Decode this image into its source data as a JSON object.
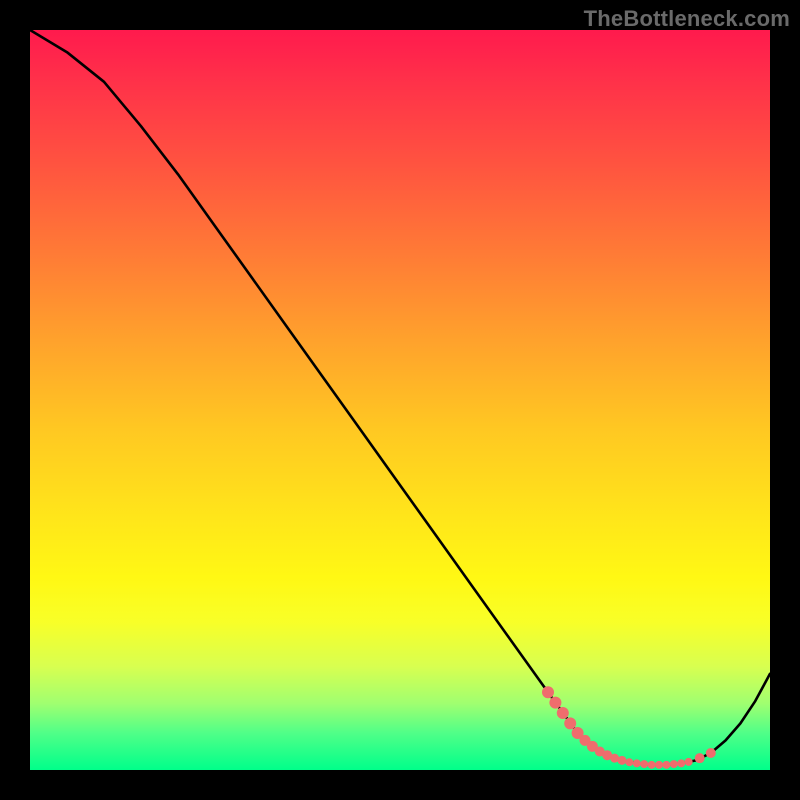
{
  "watermark": "TheBottleneck.com",
  "colors": {
    "curve_stroke": "#000000",
    "marker_fill": "#ef6d6d",
    "background": "#000000",
    "gradient_top": "#ff1a4d",
    "gradient_bottom": "#00ff8a"
  },
  "chart_data": {
    "type": "line",
    "title": "",
    "xlabel": "",
    "ylabel": "",
    "xlim": [
      0,
      100
    ],
    "ylim": [
      0,
      100
    ],
    "grid": false,
    "legend": false,
    "series": [
      {
        "name": "bottleneck-curve",
        "x": [
          0,
          5,
          10,
          15,
          20,
          25,
          30,
          35,
          40,
          45,
          50,
          55,
          60,
          65,
          70,
          74,
          76,
          78,
          80,
          82,
          84,
          86,
          88,
          90,
          92,
          94,
          96,
          98,
          100
        ],
        "y": [
          100,
          97,
          93,
          87,
          80.5,
          73.5,
          66.5,
          59.5,
          52.5,
          45.5,
          38.5,
          31.5,
          24.5,
          17.5,
          10.5,
          5,
          3.2,
          2,
          1.3,
          0.9,
          0.7,
          0.7,
          0.9,
          1.3,
          2.3,
          4,
          6.3,
          9.3,
          13
        ]
      }
    ],
    "markers": {
      "series": "bottleneck-curve",
      "color": "#ef6d6d",
      "points": [
        {
          "x": 70,
          "y": 10.5,
          "r": 6
        },
        {
          "x": 71,
          "y": 9.1,
          "r": 6
        },
        {
          "x": 72,
          "y": 7.7,
          "r": 6
        },
        {
          "x": 73,
          "y": 6.3,
          "r": 6
        },
        {
          "x": 74,
          "y": 5.0,
          "r": 6
        },
        {
          "x": 75,
          "y": 4.0,
          "r": 5.5
        },
        {
          "x": 76,
          "y": 3.2,
          "r": 5.5
        },
        {
          "x": 77,
          "y": 2.5,
          "r": 5
        },
        {
          "x": 78,
          "y": 2.0,
          "r": 5
        },
        {
          "x": 79,
          "y": 1.6,
          "r": 4.5
        },
        {
          "x": 80,
          "y": 1.3,
          "r": 4.5
        },
        {
          "x": 81,
          "y": 1.05,
          "r": 4
        },
        {
          "x": 82,
          "y": 0.9,
          "r": 4
        },
        {
          "x": 83,
          "y": 0.8,
          "r": 4
        },
        {
          "x": 84,
          "y": 0.7,
          "r": 4
        },
        {
          "x": 85,
          "y": 0.7,
          "r": 4
        },
        {
          "x": 86,
          "y": 0.7,
          "r": 4
        },
        {
          "x": 87,
          "y": 0.8,
          "r": 4
        },
        {
          "x": 88,
          "y": 0.9,
          "r": 4
        },
        {
          "x": 89,
          "y": 1.1,
          "r": 4
        },
        {
          "x": 90.5,
          "y": 1.6,
          "r": 5
        },
        {
          "x": 92,
          "y": 2.3,
          "r": 5
        }
      ]
    }
  }
}
